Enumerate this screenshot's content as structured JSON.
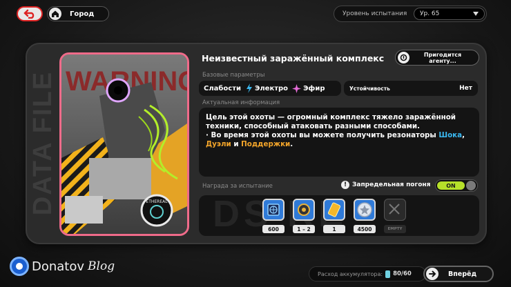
{
  "colors": {
    "accent_red": "#d22222",
    "highlight_blue": "#3ab8f0",
    "highlight_orange": "#f3a52a",
    "toggle_on": "#b6e02a",
    "card_border": "#f06b8a"
  },
  "topbar": {
    "back_icon": "back-arrow-icon",
    "home_icon": "home-icon",
    "city_label": "Город",
    "level_label": "Уровень испытания",
    "level_value": "Ур. 65"
  },
  "panel": {
    "side_watermark": "DATA FILE",
    "card_text": "WARNING",
    "card_badge": "ETHEREAL",
    "title": "Неизвестный заражённый комплекс",
    "hint_button": "Пригодится агенту...",
    "base_params_label": "Базовые параметры",
    "weakness_label": "Слабости",
    "weaknesses": [
      "Электро",
      "Эфир"
    ],
    "resistance_label": "Устойчивость",
    "resistance_value": "Нет",
    "current_info_label": "Актуальная информация",
    "info": {
      "line1": "Цель этой охоты — огромный комплекс тяжело заражённой техники, способный атаковать разными способами.",
      "line2_prefix": "· Во время этой охоты вы можете получить резонаторы ",
      "agent1": "Шока",
      "sep1": ", ",
      "agent2": "Дуэли",
      "and": " и ",
      "agent3": "Поддержки",
      "end": "."
    },
    "reward_label": "Награда за испытание",
    "chase_label": "Запредельная погоня",
    "toggle_label": "ON",
    "rewards_bg_text": "DS     RE",
    "rewards": [
      {
        "icon": "globe-chip-icon",
        "count": "600"
      },
      {
        "icon": "gear-material-icon",
        "count": "1 – 2"
      },
      {
        "icon": "battery-material-icon",
        "count": "1"
      },
      {
        "icon": "star-coin-icon",
        "count": "4500"
      },
      {
        "icon": "empty-slot-icon",
        "count": "EMPTY"
      }
    ]
  },
  "bottom": {
    "watermark_text": "Donatov",
    "watermark_blog": "Blog",
    "energy_label": "Расход аккумулятора:",
    "energy_value": "80/60",
    "go_label": "Вперёд"
  }
}
